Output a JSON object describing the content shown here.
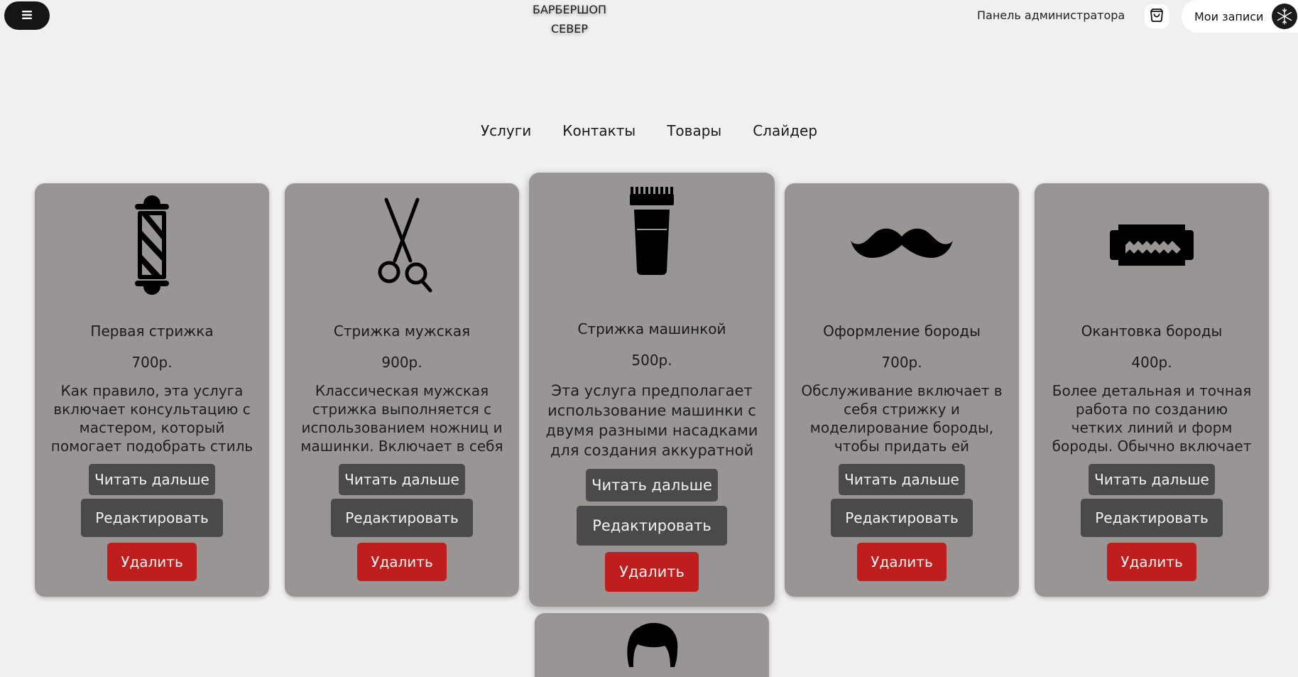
{
  "header": {
    "brand_line1": "БАРБЕРШОП",
    "brand_line2": "СЕВЕР",
    "admin_link": "Панель администратора",
    "records_button": "Мои записи"
  },
  "nav": [
    {
      "label": "Услуги"
    },
    {
      "label": "Контакты"
    },
    {
      "label": "Товары"
    },
    {
      "label": "Слайдер"
    }
  ],
  "cards": [
    {
      "icon": "barber-pole-icon",
      "title": "Первая стрижка",
      "price": "700р.",
      "description": "Как правило, эта услуга включает консультацию с мастером, который помогает подобрать стиль",
      "read_more": "Читать дальше",
      "edit": "Редактировать",
      "delete": "Удалить"
    },
    {
      "icon": "scissors-icon",
      "title": "Стрижка мужская",
      "price": "900р.",
      "description": "Классическая мужская стрижка выполняется с использованием ножниц и машинки. Включает в себя",
      "read_more": "Читать дальше",
      "edit": "Редактировать",
      "delete": "Удалить"
    },
    {
      "icon": "hair-clipper-icon",
      "title": "Стрижка машинкой",
      "price": "500р.",
      "description": "Эта услуга предполагает использование машинки с двумя разными насадками для создания аккуратной",
      "read_more": "Читать дальше",
      "edit": "Редактировать",
      "delete": "Удалить"
    },
    {
      "icon": "mustache-icon",
      "title": "Оформление бороды",
      "price": "700р.",
      "description": "Обслуживание включает в себя стрижку и моделирование бороды, чтобы придать ей",
      "read_more": "Читать дальше",
      "edit": "Редактировать",
      "delete": "Удалить"
    },
    {
      "icon": "razor-blade-icon",
      "title": "Окантовка бороды",
      "price": "400р.",
      "description": "Более детальная и точная работа по созданию четких линий и форм бороды. Обычно включает",
      "read_more": "Читать дальше",
      "edit": "Редактировать",
      "delete": "Удалить"
    }
  ],
  "partial_card": {
    "icon": "hair-icon"
  },
  "colors": {
    "background": "#f0f0f0",
    "card": "#9a9595",
    "button_dark": "#4a4a4a",
    "button_delete": "#bf1e1e"
  }
}
